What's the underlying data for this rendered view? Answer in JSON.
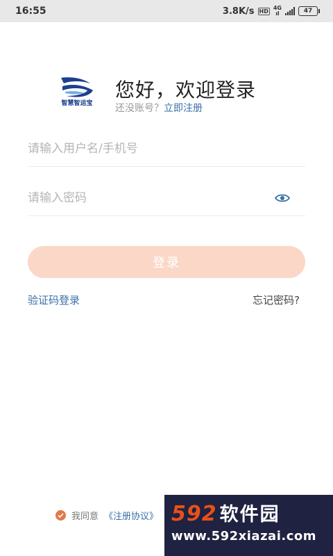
{
  "status_bar": {
    "time": "16:55",
    "speed": "3.8K/s",
    "hd": "HD",
    "network_top": "4G",
    "network_bottom": "ıl",
    "battery": "47"
  },
  "logo": {
    "text": "智慧智运宝"
  },
  "greeting": "您好，欢迎登录",
  "register": {
    "prompt": "还没账号？",
    "link": "立即注册"
  },
  "form": {
    "username_placeholder": "请输入用户名/手机号",
    "password_placeholder": "请输入密码"
  },
  "login_button": "登录",
  "sms_login": "验证码登录",
  "forgot_password": "忘记密码?",
  "agreement": {
    "prefix": "我同意",
    "link": "《注册协议》"
  },
  "watermark": {
    "number": "592",
    "title": "软件园",
    "url": "www.592xiazai.com"
  },
  "colors": {
    "accent_blue": "#3a6fa8",
    "login_button_bg": "#fbd7c7",
    "check_orange": "#e07a4a"
  }
}
